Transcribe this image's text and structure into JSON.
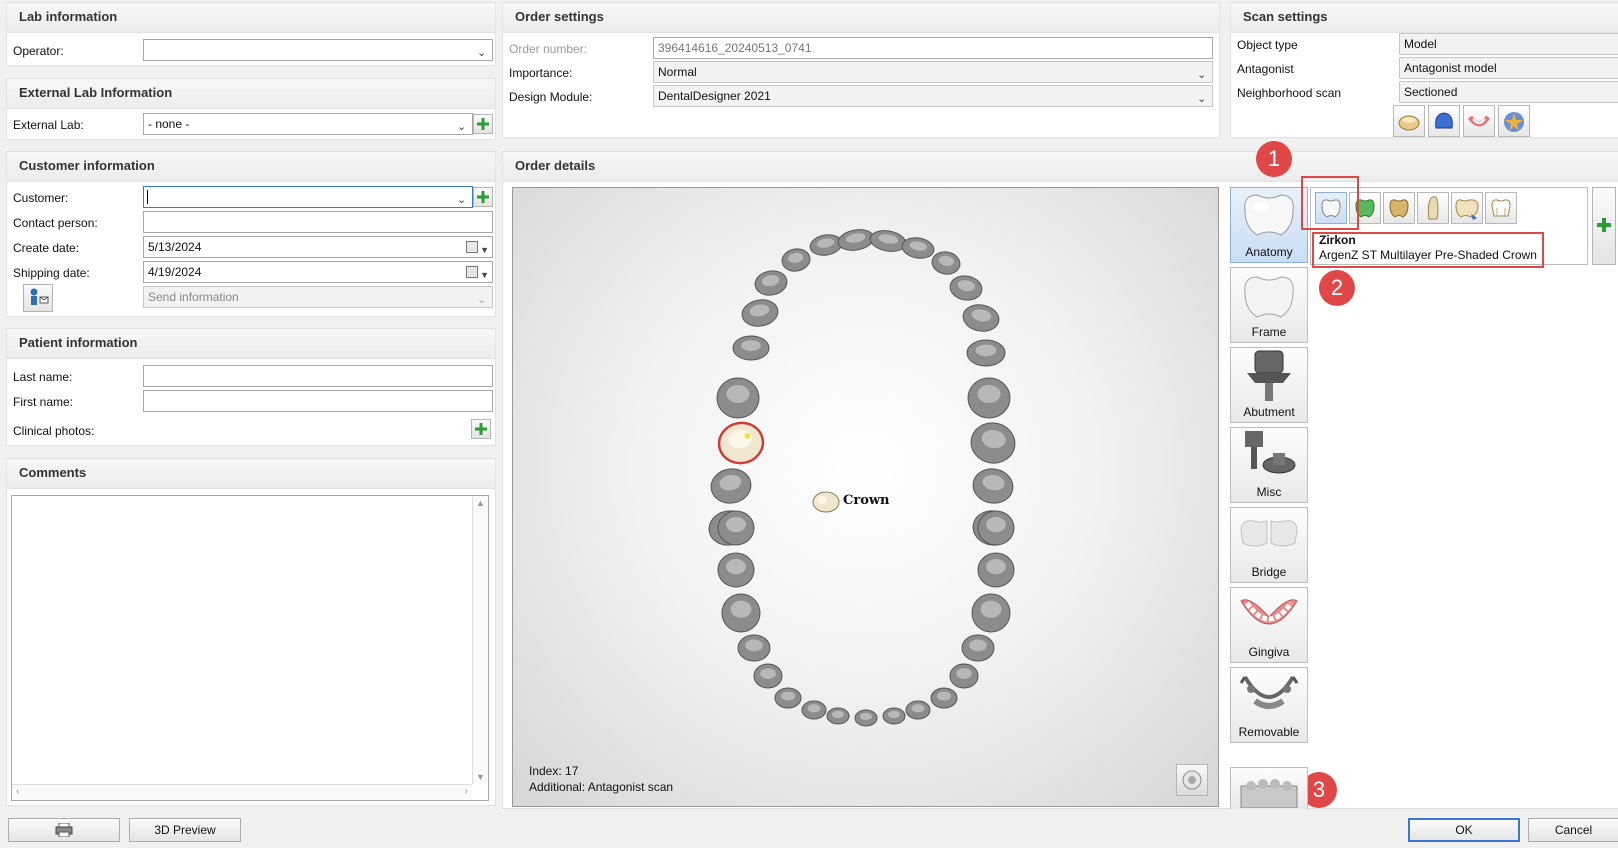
{
  "lab_info": {
    "title": "Lab information",
    "operator_label": "Operator:",
    "operator_value": ""
  },
  "external_lab": {
    "title": "External Lab Information",
    "label": "External Lab:",
    "value": "- none -"
  },
  "customer_info": {
    "title": "Customer information",
    "customer_label": "Customer:",
    "customer_value": "",
    "contact_label": "Contact person:",
    "contact_value": "",
    "create_label": "Create date:",
    "create_value": "5/13/2024",
    "shipping_label": "Shipping date:",
    "shipping_value": "4/19/2024",
    "send_info": "Send information"
  },
  "patient_info": {
    "title": "Patient information",
    "last_label": "Last name:",
    "last_value": "",
    "first_label": "First name:",
    "first_value": "",
    "photos_label": "Clinical photos:"
  },
  "comments": {
    "title": "Comments",
    "value": ""
  },
  "order_settings": {
    "title": "Order settings",
    "number_label": "Order number:",
    "number_value": "396414616_20240513_0741",
    "importance_label": "Importance:",
    "importance_value": "Normal",
    "design_label": "Design Module:",
    "design_value": "DentalDesigner 2021"
  },
  "scan_settings": {
    "title": "Scan settings",
    "object_label": "Object type",
    "object_value": "Model",
    "antagonist_label": "Antagonist",
    "antagonist_value": "Antagonist model",
    "neighborhood_label": "Neighborhood scan",
    "neighborhood_value": "Sectioned",
    "icons": [
      "crown-scan-icon",
      "full-arch-icon",
      "gingiva-scan-icon",
      "scan-star-icon"
    ]
  },
  "order_details": {
    "title": "Order details",
    "tooth_label": "Crown",
    "index_text": "Index: 17",
    "additional_text": "Additional: Antagonist scan"
  },
  "material": {
    "name": "Zirkon",
    "description": "ArgenZ ST Multilayer Pre-Shaded Crown",
    "icons": [
      "anatomic-crown-icon",
      "wax-crown-icon",
      "gold-crown-icon",
      "veneer-icon",
      "bridge-crown-icon",
      "coping-icon"
    ]
  },
  "side_buttons": [
    {
      "label": "Anatomy",
      "icon": "anatomy-crown-icon",
      "selected": true
    },
    {
      "label": "Frame",
      "icon": "frame-crown-icon"
    },
    {
      "label": "Abutment",
      "icon": "abutment-icon"
    },
    {
      "label": "Misc",
      "icon": "misc-icon"
    },
    {
      "label": "Bridge",
      "icon": "bridge-icon"
    },
    {
      "label": "Gingiva",
      "icon": "gingiva-icon"
    },
    {
      "label": "Removable",
      "icon": "removable-icon"
    }
  ],
  "badges": [
    "1",
    "2",
    "3"
  ],
  "bottom": {
    "preview_label": "3D Preview",
    "ok_label": "OK",
    "cancel_label": "Cancel"
  },
  "colors": {
    "accent": "#3a78d6",
    "badge": "#e04848",
    "plus": "#2e9b3a"
  }
}
